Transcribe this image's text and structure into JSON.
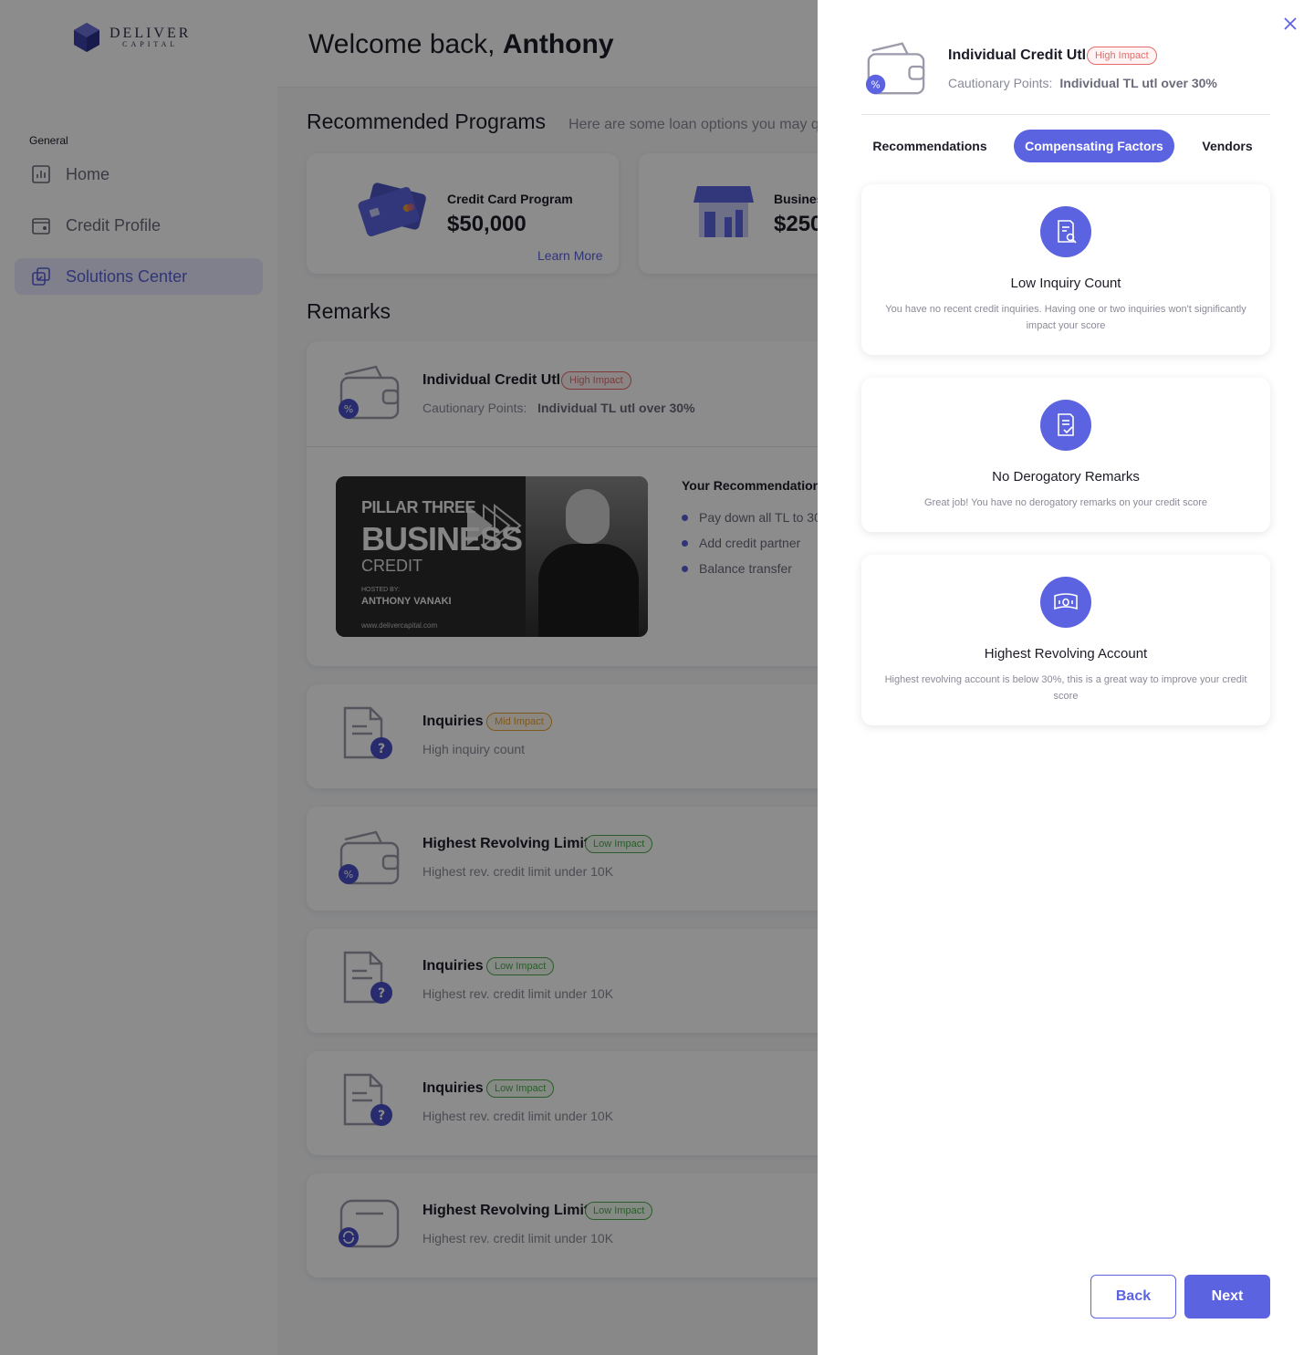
{
  "app": {
    "logo": {
      "line1": "DELIVER",
      "line2": "CAPITAL"
    },
    "welcome": {
      "prefix": "Welcome back,",
      "name": "Anthony"
    },
    "sidebar": {
      "group_label": "General",
      "items": [
        {
          "label": "Home",
          "icon": "bar-chart-icon"
        },
        {
          "label": "Credit Profile",
          "icon": "wallet-icon"
        },
        {
          "label": "Solutions Center",
          "icon": "solutions-icon",
          "active": true
        }
      ]
    },
    "recommended": {
      "title": "Recommended Programs",
      "subtitle": "Here are some loan options you may qu",
      "programs": [
        {
          "title": "Credit Card Program",
          "amount": "$50,000",
          "link": "Learn More"
        },
        {
          "title": "Busines",
          "amount": "$250"
        }
      ]
    },
    "remarks": {
      "title": "Remarks",
      "items": [
        {
          "title": "Individual Credit Utl",
          "badge": "High Impact",
          "sub_label": "Cautionary Points:",
          "sub_value": "Individual TL utl over 30%"
        },
        {
          "title": "Inquiries",
          "badge": "Mid Impact",
          "sub": "High inquiry count"
        },
        {
          "title": "Highest Revolving Limit",
          "badge": "Low Impact",
          "sub": "Highest rev. credit limit under 10K"
        },
        {
          "title": "Inquiries",
          "badge": "Low Impact",
          "sub": "Highest rev. credit limit under 10K"
        },
        {
          "title": "Inquiries",
          "badge": "Low Impact",
          "sub": "Highest rev. credit limit under 10K"
        },
        {
          "title": "Highest Revolving Limit",
          "badge": "Low Impact",
          "sub": "Highest rev. credit limit under 10K"
        }
      ]
    },
    "video": {
      "line1": "PILLAR THREE",
      "line2": "BUSINESS",
      "line3": "CREDIT",
      "hosted_label": "HOSTED BY:",
      "host": "ANTHONY VANAKI",
      "url": "www.delivercapital.com"
    },
    "recommendation_list": {
      "heading": "Your  Recommendation",
      "bullets": [
        "Pay down all TL to 30",
        "Add credit partner",
        "Balance transfer"
      ]
    }
  },
  "drawer": {
    "title": "Individual Credit Utl",
    "badge": "High Impact",
    "sub_label": "Cautionary Points:",
    "sub_value": "Individual TL utl over 30%",
    "tabs": [
      {
        "label": "Recommendations",
        "active": false
      },
      {
        "label": "Compensating Factors",
        "active": true
      },
      {
        "label": "Vendors",
        "active": false
      }
    ],
    "factors": [
      {
        "title": "Low Inquiry Count",
        "desc": "You have no recent credit inquiries. Having one or two inquiries won't significantly impact your score",
        "icon": "document-search-icon"
      },
      {
        "title": "No Derogatory Remarks",
        "desc": "Great job! You have no derogatory remarks on your credit score",
        "icon": "document-check-icon"
      },
      {
        "title": "Highest Revolving Account",
        "desc": "Highest revolving account is below 30%, this is a great way to improve your credit score",
        "icon": "banknote-icon"
      }
    ],
    "buttons": {
      "back": "Back",
      "next": "Next"
    }
  },
  "colors": {
    "accent": "#5c63e0",
    "high": "#e56b6b",
    "mid": "#e5a030",
    "low": "#4fa84f"
  }
}
